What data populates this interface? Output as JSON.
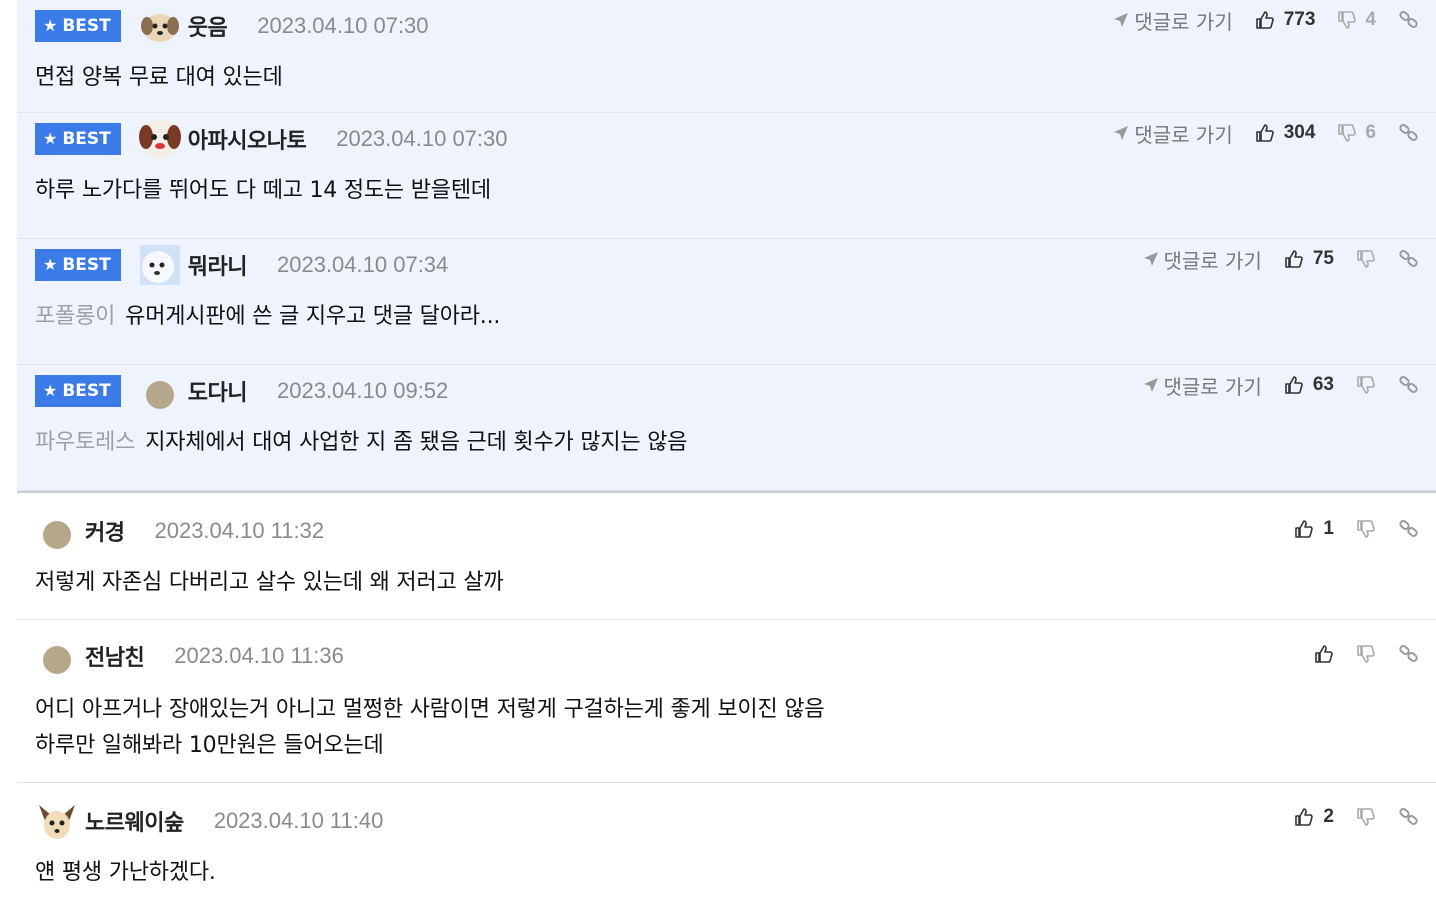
{
  "labels": {
    "best": "BEST",
    "goto": "댓글로 가기"
  },
  "colors": {
    "best_badge": "#3b7be8",
    "best_bg": "#eef3fd",
    "muted": "#8a8a8a"
  },
  "comments": [
    {
      "best": true,
      "nick": "웃음",
      "date": "2023.04.10 07:30",
      "ref": "",
      "text": "면접 양복 무료 대여 있는데",
      "up": "773",
      "down": "4",
      "avatar": "dog-avatar"
    },
    {
      "best": true,
      "nick": "아파시오나토",
      "date": "2023.04.10 07:30",
      "ref": "",
      "text": "하루 노가다를 뛰어도 다 떼고 14 정도는 받을텐데",
      "up": "304",
      "down": "6",
      "avatar": "puppy-avatar"
    },
    {
      "best": true,
      "nick": "뭐라니",
      "date": "2023.04.10 07:34",
      "ref": "포폴롱이",
      "text": "유머게시판에 쓴 글 지우고 댓글 달아라...",
      "up": "75",
      "down": "",
      "avatar": "white-dog-avatar"
    },
    {
      "best": true,
      "nick": "도다니",
      "date": "2023.04.10 09:52",
      "ref": "파우토레스",
      "text": "지자체에서 대여 사업한 지 좀 됐음 근데 횟수가 많지는 않음",
      "up": "63",
      "down": "",
      "avatar": "default-avatar"
    },
    {
      "best": false,
      "nick": "커경",
      "date": "2023.04.10 11:32",
      "ref": "",
      "text": "저렇게 자존심 다버리고 살수 있는데 왜 저러고 살까",
      "up": "1",
      "down": "",
      "avatar": "default-avatar"
    },
    {
      "best": false,
      "nick": "전남친",
      "date": "2023.04.10 11:36",
      "ref": "",
      "text": "어디 아프거나 장애있는거 아니고 멀쩡한 사람이면 저렇게 구걸하는게 좋게 보이진 않음",
      "text2": "하루만 일해봐라 10만원은 들어오는데",
      "up": "",
      "down": "",
      "avatar": "default-avatar"
    },
    {
      "best": false,
      "nick": "노르웨이숲",
      "date": "2023.04.10 11:40",
      "ref": "",
      "text": "얜 평생 가난하겠다.",
      "up": "2",
      "down": "",
      "avatar": "chihuahua-avatar"
    }
  ]
}
